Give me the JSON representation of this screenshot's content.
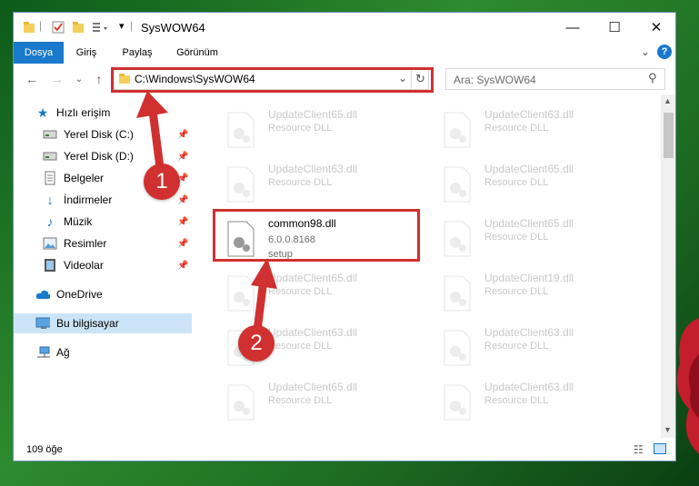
{
  "window": {
    "title": "SysWOW64",
    "controls": {
      "minimize": "—",
      "maximize": "☐",
      "close": "✕"
    }
  },
  "ribbon": {
    "tabs": [
      {
        "label": "Dosya",
        "active": true
      },
      {
        "label": "Giriş"
      },
      {
        "label": "Paylaş"
      },
      {
        "label": "Görünüm"
      }
    ]
  },
  "address": {
    "path": "C:\\Windows\\SysWOW64"
  },
  "search": {
    "placeholder": "Ara: SysWOW64"
  },
  "sidebar": {
    "quick_access": "Hızlı erişim",
    "items": [
      {
        "label": "Yerel Disk (C:)",
        "icon": "drive-icon",
        "pinned": true
      },
      {
        "label": "Yerel Disk (D:)",
        "icon": "drive-icon",
        "pinned": true
      },
      {
        "label": "Belgeler",
        "icon": "documents-icon",
        "pinned": true
      },
      {
        "label": "İndirmeler",
        "icon": "downloads-icon",
        "pinned": true
      },
      {
        "label": "Müzik",
        "icon": "music-icon",
        "pinned": true
      },
      {
        "label": "Resimler",
        "icon": "pictures-icon",
        "pinned": true
      },
      {
        "label": "Videolar",
        "icon": "videos-icon",
        "pinned": true
      }
    ],
    "onedrive": "OneDrive",
    "this_pc": "Bu bilgisayar",
    "network": "Ağ"
  },
  "files": {
    "left": [
      {
        "name": "UpdateClient65.dll",
        "sub": "Resource DLL"
      },
      {
        "name": "UpdateClient63.dll",
        "sub": "Resource DLL"
      },
      {
        "name": "common98.dll",
        "version": "6.0.0.8168",
        "type": "setup",
        "highlighted": true
      },
      {
        "name": "UpdateClient65.dll",
        "sub": "Resource DLL"
      },
      {
        "name": "UpdateClient63.dll",
        "sub": "Resource DLL"
      },
      {
        "name": "UpdateClient65.dll",
        "sub": "Resource DLL"
      }
    ],
    "right": [
      {
        "name": "UpdateClient63.dll",
        "sub": "Resource DLL"
      },
      {
        "name": "UpdateClient65.dll",
        "sub": "Resource DLL"
      },
      {
        "name": "UpdateClient65.dll",
        "sub": "Resource DLL"
      },
      {
        "name": "UpdateClient19.dll",
        "sub": "Resource DLL"
      },
      {
        "name": "UpdateClient63.dll",
        "sub": "Resource DLL"
      },
      {
        "name": "UpdateClient63.dll",
        "sub": "Resource DLL"
      }
    ]
  },
  "status": {
    "count": "109 öğe"
  },
  "callouts": {
    "one": "1",
    "two": "2"
  },
  "colors": {
    "accent": "#1979ca",
    "highlight": "#d0302f",
    "selected": "#cce4f7"
  }
}
